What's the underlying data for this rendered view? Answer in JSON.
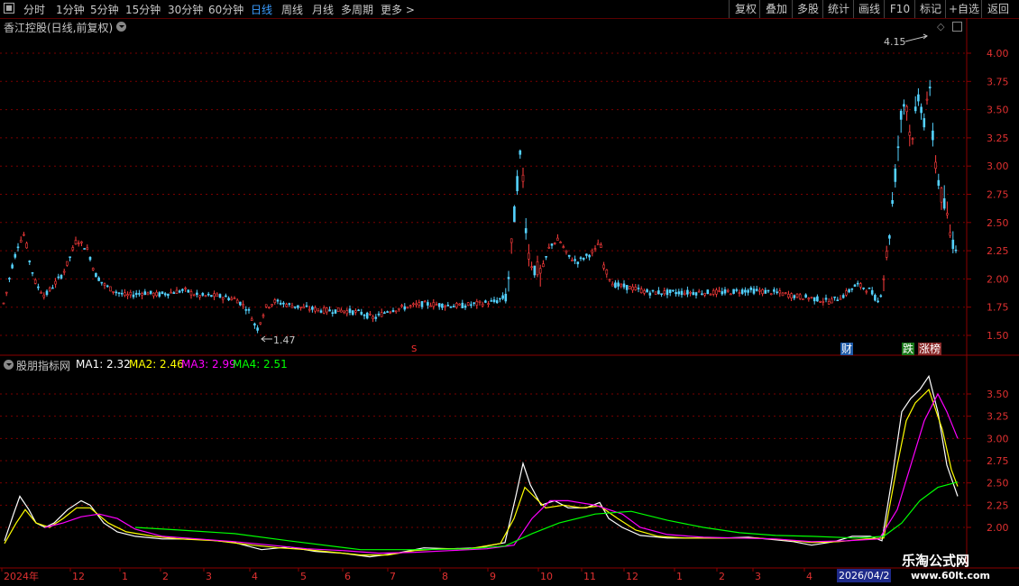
{
  "toolbar": {
    "left_items": [
      "分时",
      "1分钟",
      "5分钟",
      "15分钟",
      "30分钟",
      "60分钟",
      "日线",
      "周线",
      "月线",
      "多周期",
      "更多 >"
    ],
    "active": "日线",
    "right_items": [
      "复权",
      "叠加",
      "多股",
      "统计",
      "画线",
      "F10",
      "标记",
      "+自选",
      "返回"
    ]
  },
  "main_chart": {
    "title": "香江控股(日线,前复权)",
    "y_ticks": [
      "4.00",
      "3.75",
      "3.50",
      "3.25",
      "3.00",
      "2.75",
      "2.50",
      "2.25",
      "2.00",
      "1.75",
      "1.50"
    ],
    "high_label": "4.15",
    "low_label": "1.47",
    "tags": {
      "cai": "财",
      "die": "跌",
      "zhang": "涨榜",
      "s": "S"
    }
  },
  "indicator": {
    "name": "股朋指标网",
    "ma_labels": [
      {
        "label": "MA1: 2.32",
        "color": "#ffffff"
      },
      {
        "label": "MA2: 2.46",
        "color": "#ffff00"
      },
      {
        "label": "MA3: 2.99",
        "color": "#ff00ff"
      },
      {
        "label": "MA4: 2.51",
        "color": "#00ff00"
      }
    ],
    "y_ticks": [
      "3.50",
      "3.25",
      "3.00",
      "2.75",
      "2.50",
      "2.25",
      "2.00"
    ]
  },
  "x_axis": {
    "labels": [
      "2024年",
      "12",
      "1",
      "2",
      "3",
      "4",
      "5",
      "6",
      "7",
      "8",
      "9",
      "10",
      "11",
      "12",
      "1",
      "2",
      "3",
      "4"
    ],
    "highlight": "2026/04/2"
  },
  "watermark": {
    "cn": "乐淘公式网",
    "url": "www.60lt.com"
  },
  "chart_data": {
    "type": "candlestick",
    "ylim": [
      1.4,
      4.2
    ],
    "price_path": [
      [
        0,
        1.72
      ],
      [
        5,
        1.8
      ],
      [
        13,
        2.1
      ],
      [
        20,
        2.3
      ],
      [
        27,
        2.4
      ],
      [
        33,
        2.15
      ],
      [
        40,
        1.95
      ],
      [
        50,
        1.85
      ],
      [
        60,
        1.95
      ],
      [
        70,
        2.05
      ],
      [
        78,
        2.2
      ],
      [
        85,
        2.35
      ],
      [
        92,
        2.3
      ],
      [
        98,
        2.25
      ],
      [
        105,
        2.05
      ],
      [
        115,
        1.95
      ],
      [
        125,
        1.9
      ],
      [
        140,
        1.85
      ],
      [
        160,
        1.88
      ],
      [
        175,
        1.86
      ],
      [
        190,
        1.88
      ],
      [
        205,
        1.9
      ],
      [
        220,
        1.85
      ],
      [
        240,
        1.85
      ],
      [
        262,
        1.82
      ],
      [
        275,
        1.73
      ],
      [
        285,
        1.55
      ],
      [
        295,
        1.75
      ],
      [
        305,
        1.8
      ],
      [
        320,
        1.77
      ],
      [
        340,
        1.74
      ],
      [
        360,
        1.72
      ],
      [
        380,
        1.72
      ],
      [
        400,
        1.7
      ],
      [
        415,
        1.65
      ],
      [
        430,
        1.72
      ],
      [
        450,
        1.75
      ],
      [
        470,
        1.78
      ],
      [
        490,
        1.77
      ],
      [
        510,
        1.76
      ],
      [
        530,
        1.78
      ],
      [
        550,
        1.8
      ],
      [
        562,
        1.85
      ],
      [
        568,
        2.35
      ],
      [
        572,
        2.7
      ],
      [
        576,
        3.1
      ],
      [
        580,
        2.9
      ],
      [
        585,
        2.25
      ],
      [
        592,
        2.1
      ],
      [
        600,
        2.05
      ],
      [
        610,
        2.3
      ],
      [
        620,
        2.35
      ],
      [
        630,
        2.2
      ],
      [
        640,
        2.15
      ],
      [
        650,
        2.2
      ],
      [
        660,
        2.25
      ],
      [
        665,
        2.35
      ],
      [
        670,
        2.1
      ],
      [
        680,
        1.95
      ],
      [
        700,
        1.92
      ],
      [
        720,
        1.88
      ],
      [
        745,
        1.88
      ],
      [
        770,
        1.88
      ],
      [
        800,
        1.88
      ],
      [
        830,
        1.9
      ],
      [
        860,
        1.88
      ],
      [
        880,
        1.85
      ],
      [
        900,
        1.83
      ],
      [
        920,
        1.8
      ],
      [
        935,
        1.85
      ],
      [
        950,
        1.95
      ],
      [
        965,
        1.9
      ],
      [
        975,
        1.78
      ],
      [
        985,
        2.3
      ],
      [
        990,
        2.7
      ],
      [
        995,
        3.1
      ],
      [
        1000,
        3.5
      ],
      [
        1005,
        3.6
      ],
      [
        1010,
        3.2
      ],
      [
        1015,
        3.45
      ],
      [
        1020,
        3.6
      ],
      [
        1025,
        3.4
      ],
      [
        1030,
        3.75
      ],
      [
        1035,
        3.2
      ],
      [
        1040,
        2.9
      ],
      [
        1045,
        2.7
      ],
      [
        1050,
        2.55
      ],
      [
        1055,
        2.35
      ],
      [
        1062,
        2.3
      ]
    ],
    "ma_series": [
      {
        "name": "MA1",
        "color": "#ffffff",
        "values": [
          [
            5,
            1.85
          ],
          [
            15,
            2.15
          ],
          [
            22,
            2.35
          ],
          [
            32,
            2.2
          ],
          [
            40,
            2.05
          ],
          [
            50,
            2.0
          ],
          [
            60,
            2.05
          ],
          [
            75,
            2.2
          ],
          [
            90,
            2.3
          ],
          [
            100,
            2.25
          ],
          [
            115,
            2.05
          ],
          [
            130,
            1.95
          ],
          [
            150,
            1.9
          ],
          [
            180,
            1.87
          ],
          [
            200,
            1.87
          ],
          [
            230,
            1.86
          ],
          [
            260,
            1.83
          ],
          [
            290,
            1.75
          ],
          [
            320,
            1.78
          ],
          [
            350,
            1.73
          ],
          [
            380,
            1.71
          ],
          [
            410,
            1.67
          ],
          [
            440,
            1.71
          ],
          [
            470,
            1.77
          ],
          [
            500,
            1.76
          ],
          [
            530,
            1.77
          ],
          [
            560,
            1.83
          ],
          [
            572,
            2.35
          ],
          [
            580,
            2.72
          ],
          [
            588,
            2.48
          ],
          [
            600,
            2.25
          ],
          [
            615,
            2.3
          ],
          [
            630,
            2.22
          ],
          [
            650,
            2.22
          ],
          [
            665,
            2.28
          ],
          [
            675,
            2.1
          ],
          [
            690,
            2.0
          ],
          [
            710,
            1.91
          ],
          [
            740,
            1.88
          ],
          [
            770,
            1.88
          ],
          [
            800,
            1.88
          ],
          [
            830,
            1.89
          ],
          [
            860,
            1.86
          ],
          [
            880,
            1.84
          ],
          [
            900,
            1.8
          ],
          [
            925,
            1.84
          ],
          [
            945,
            1.9
          ],
          [
            965,
            1.9
          ],
          [
            978,
            1.85
          ],
          [
            990,
            2.6
          ],
          [
            1000,
            3.3
          ],
          [
            1010,
            3.45
          ],
          [
            1020,
            3.55
          ],
          [
            1030,
            3.7
          ],
          [
            1040,
            3.3
          ],
          [
            1050,
            2.7
          ],
          [
            1062,
            2.35
          ]
        ]
      },
      {
        "name": "MA2",
        "color": "#ffff00",
        "values": [
          [
            5,
            1.82
          ],
          [
            18,
            2.05
          ],
          [
            28,
            2.2
          ],
          [
            40,
            2.05
          ],
          [
            55,
            2.0
          ],
          [
            70,
            2.1
          ],
          [
            85,
            2.22
          ],
          [
            100,
            2.22
          ],
          [
            120,
            2.05
          ],
          [
            140,
            1.95
          ],
          [
            170,
            1.9
          ],
          [
            200,
            1.87
          ],
          [
            240,
            1.85
          ],
          [
            280,
            1.8
          ],
          [
            310,
            1.77
          ],
          [
            340,
            1.75
          ],
          [
            370,
            1.72
          ],
          [
            400,
            1.69
          ],
          [
            430,
            1.69
          ],
          [
            460,
            1.74
          ],
          [
            490,
            1.76
          ],
          [
            520,
            1.76
          ],
          [
            555,
            1.82
          ],
          [
            570,
            2.1
          ],
          [
            582,
            2.45
          ],
          [
            592,
            2.35
          ],
          [
            605,
            2.22
          ],
          [
            625,
            2.25
          ],
          [
            645,
            2.22
          ],
          [
            665,
            2.24
          ],
          [
            685,
            2.1
          ],
          [
            705,
            1.97
          ],
          [
            730,
            1.9
          ],
          [
            760,
            1.88
          ],
          [
            800,
            1.88
          ],
          [
            840,
            1.88
          ],
          [
            870,
            1.86
          ],
          [
            900,
            1.83
          ],
          [
            930,
            1.84
          ],
          [
            960,
            1.87
          ],
          [
            980,
            1.88
          ],
          [
            995,
            2.7
          ],
          [
            1005,
            3.2
          ],
          [
            1015,
            3.4
          ],
          [
            1030,
            3.55
          ],
          [
            1045,
            3.1
          ],
          [
            1055,
            2.65
          ],
          [
            1062,
            2.46
          ]
        ]
      },
      {
        "name": "MA3",
        "color": "#ff00ff",
        "values": [
          [
            50,
            2.0
          ],
          [
            70,
            2.05
          ],
          [
            90,
            2.12
          ],
          [
            110,
            2.15
          ],
          [
            130,
            2.1
          ],
          [
            150,
            1.98
          ],
          [
            180,
            1.9
          ],
          [
            220,
            1.87
          ],
          [
            260,
            1.84
          ],
          [
            300,
            1.8
          ],
          [
            340,
            1.76
          ],
          [
            380,
            1.74
          ],
          [
            420,
            1.71
          ],
          [
            460,
            1.72
          ],
          [
            500,
            1.74
          ],
          [
            540,
            1.76
          ],
          [
            570,
            1.8
          ],
          [
            590,
            2.1
          ],
          [
            610,
            2.3
          ],
          [
            630,
            2.3
          ],
          [
            660,
            2.25
          ],
          [
            690,
            2.15
          ],
          [
            710,
            2.0
          ],
          [
            740,
            1.92
          ],
          [
            780,
            1.89
          ],
          [
            820,
            1.88
          ],
          [
            860,
            1.87
          ],
          [
            900,
            1.84
          ],
          [
            940,
            1.85
          ],
          [
            975,
            1.87
          ],
          [
            995,
            2.2
          ],
          [
            1010,
            2.7
          ],
          [
            1025,
            3.2
          ],
          [
            1040,
            3.5
          ],
          [
            1050,
            3.3
          ],
          [
            1062,
            3.0
          ]
        ]
      },
      {
        "name": "MA4",
        "color": "#00ff00",
        "values": [
          [
            150,
            2.0
          ],
          [
            200,
            1.97
          ],
          [
            260,
            1.93
          ],
          [
            320,
            1.85
          ],
          [
            400,
            1.75
          ],
          [
            460,
            1.75
          ],
          [
            520,
            1.76
          ],
          [
            560,
            1.79
          ],
          [
            590,
            1.93
          ],
          [
            620,
            2.05
          ],
          [
            660,
            2.15
          ],
          [
            700,
            2.18
          ],
          [
            740,
            2.08
          ],
          [
            780,
            2.0
          ],
          [
            820,
            1.94
          ],
          [
            860,
            1.91
          ],
          [
            900,
            1.9
          ],
          [
            950,
            1.88
          ],
          [
            980,
            1.9
          ],
          [
            1000,
            2.05
          ],
          [
            1020,
            2.3
          ],
          [
            1040,
            2.45
          ],
          [
            1062,
            2.51
          ]
        ]
      }
    ]
  }
}
